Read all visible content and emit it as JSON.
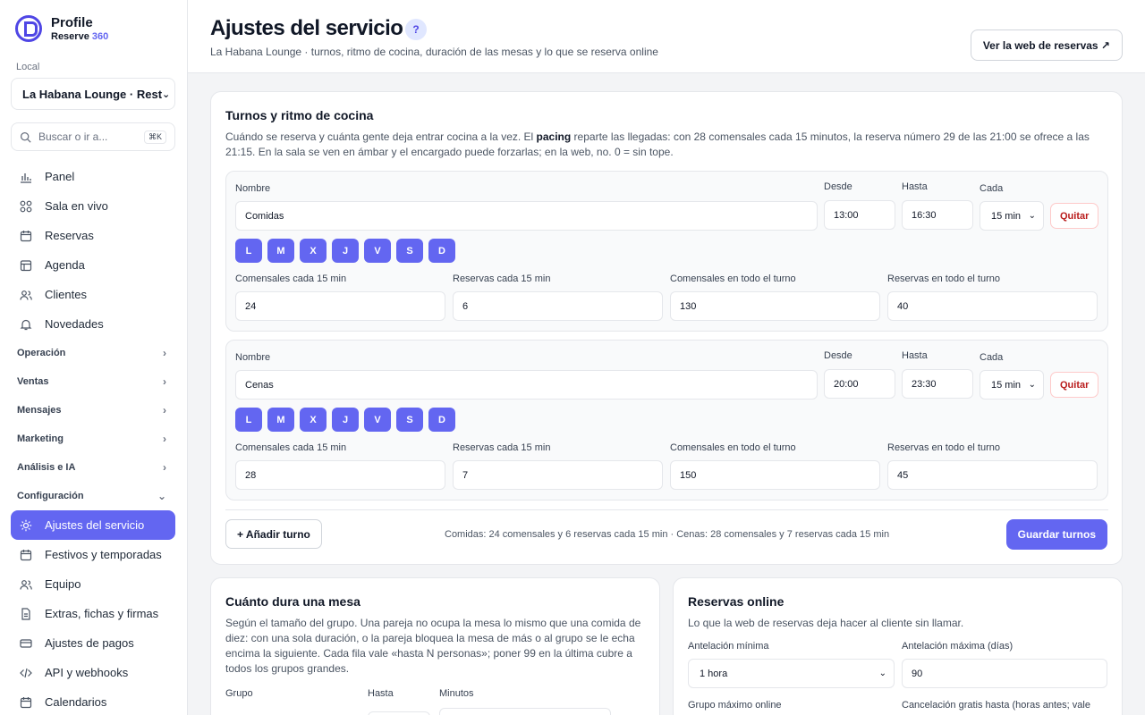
{
  "brand": {
    "name": "Profile",
    "sub": "Reserve",
    "sub_accent": "360"
  },
  "sidebar": {
    "local_label": "Local",
    "local_value": "La Habana Lounge · Rest",
    "search_placeholder": "Buscar o ir a...",
    "search_kbd": "⌘K",
    "items": [
      {
        "label": "Panel",
        "icon": "chart-icon"
      },
      {
        "label": "Sala en vivo",
        "icon": "grid-icon"
      },
      {
        "label": "Reservas",
        "icon": "calendar-icon"
      },
      {
        "label": "Agenda",
        "icon": "table-icon"
      },
      {
        "label": "Clientes",
        "icon": "users-icon"
      },
      {
        "label": "Novedades",
        "icon": "bell-icon"
      }
    ],
    "groups": [
      "Operación",
      "Ventas",
      "Mensajes",
      "Marketing",
      "Análisis e IA",
      "Configuración"
    ],
    "config_items": [
      {
        "label": "Ajustes del servicio",
        "icon": "sun-icon"
      },
      {
        "label": "Festivos y temporadas",
        "icon": "calendar-icon"
      },
      {
        "label": "Equipo",
        "icon": "users-icon"
      },
      {
        "label": "Extras, fichas y firmas",
        "icon": "document-icon"
      },
      {
        "label": "Ajustes de pagos",
        "icon": "card-icon"
      },
      {
        "label": "API y webhooks",
        "icon": "code-icon"
      },
      {
        "label": "Calendarios",
        "icon": "calendar-icon"
      }
    ]
  },
  "header": {
    "title": "Ajustes del servicio",
    "help": "?",
    "subtitle": "La Habana Lounge · turnos, ritmo de cocina, duración de las mesas y lo que se reserva online",
    "web_button": "Ver la web de reservas ↗"
  },
  "turnos": {
    "title": "Turnos y ritmo de cocina",
    "desc_1": "Cuándo se reserva y cuánta gente deja entrar cocina a la vez. El ",
    "desc_bold": "pacing",
    "desc_2": " reparte las llegadas: con 28 comensales cada 15 minutos, la reserva número 29 de las 21:00 se ofrece a las 21:15. En la sala se ven en ámbar y el encargado puede forzarlas; en la web, no. 0 = sin tope.",
    "labels": {
      "nombre": "Nombre",
      "desde": "Desde",
      "hasta": "Hasta",
      "cada": "Cada",
      "com15": "Comensales cada 15 min",
      "res15": "Reservas cada 15 min",
      "comTot": "Comensales en todo el turno",
      "resTot": "Reservas en todo el turno",
      "quitar": "Quitar"
    },
    "days": [
      "L",
      "M",
      "X",
      "J",
      "V",
      "S",
      "D"
    ],
    "rows": [
      {
        "nombre": "Comidas",
        "desde": "13:00",
        "hasta": "16:30",
        "cada": "15 min",
        "com15": "24",
        "res15": "6",
        "comTot": "130",
        "resTot": "40"
      },
      {
        "nombre": "Cenas",
        "desde": "20:00",
        "hasta": "23:30",
        "cada": "15 min",
        "com15": "28",
        "res15": "7",
        "comTot": "150",
        "resTot": "45"
      }
    ],
    "add_button": "+ Añadir turno",
    "summary": "Comidas: 24 comensales y 6 reservas cada 15 min · Cenas: 28 comensales y 7 reservas cada 15 min",
    "save_button": "Guardar turnos"
  },
  "duracion": {
    "title": "Cuánto dura una mesa",
    "desc": "Según el tamaño del grupo. Una pareja no ocupa la mesa lo mismo que una comida de diez: con una sola duración, o la pareja bloquea la mesa de más o al grupo se le echa encima la siguiente. Cada fila vale «hasta N personas»; poner 99 en la última cubre a todos los grupos grandes.",
    "col_grupo": "Grupo",
    "col_hasta": "Hasta",
    "col_minutos": "Minutos"
  },
  "online": {
    "title": "Reservas online",
    "desc": "Lo que la web de reservas deja hacer al cliente sin llamar.",
    "min_label": "Antelación mínima",
    "min_value": "1 hora",
    "max_label": "Antelación máxima (días)",
    "max_value": "90",
    "group_label": "Grupo máximo online",
    "cancel_label": "Cancelación gratis hasta (horas antes; vale"
  }
}
